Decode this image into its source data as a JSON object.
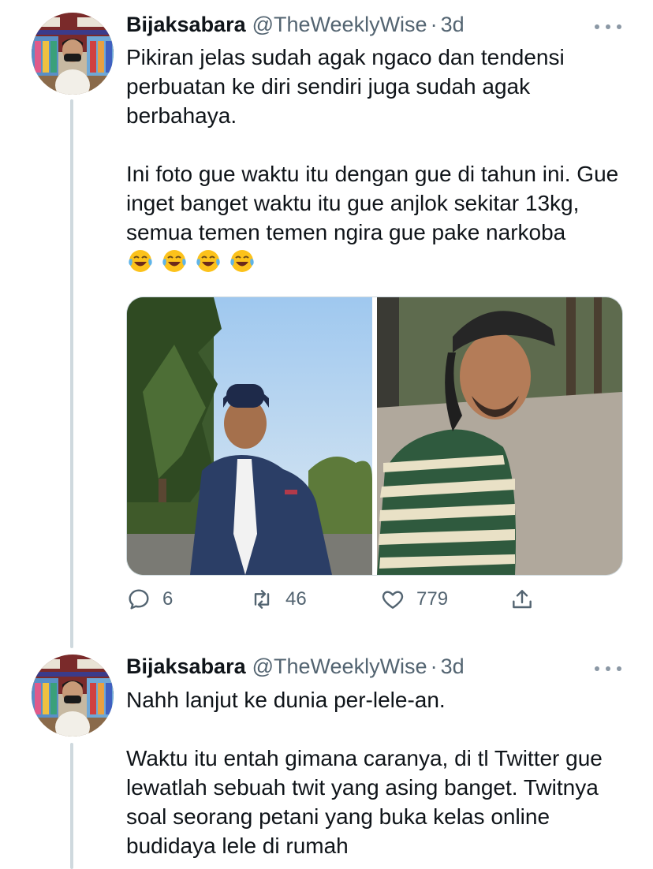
{
  "tweets": [
    {
      "name": "Bijaksabara",
      "handle": "@TheWeeklyWise",
      "separator": "·",
      "time": "3d",
      "paragraphs": [
        "Pikiran jelas sudah agak ngaco dan tendensi perbuatan ke diri sendiri juga sudah agak berbahaya.",
        "Ini foto gue waktu itu dengan gue di tahun ini. Gue inget banget waktu itu gue anjlok sekitar 13kg, semua temen temen ngira gue pake narkoba"
      ],
      "emoji": [
        "face-with-tears-of-joy",
        "face-with-tears-of-joy",
        "face-with-tears-of-joy",
        "face-with-tears-of-joy"
      ],
      "media": [
        {
          "description_icon": "photo-man-with-cap-and-suit"
        },
        {
          "description_icon": "photo-man-with-striped-shirt"
        }
      ],
      "actions": {
        "reply": "6",
        "retweet": "46",
        "like": "779"
      }
    },
    {
      "name": "Bijaksabara",
      "handle": "@TheWeeklyWise",
      "separator": "·",
      "time": "3d",
      "paragraphs": [
        "Nahh lanjut ke dunia per-lele-an.",
        "Waktu itu entah gimana caranya, di tl Twitter gue lewatlah sebuah twit yang asing banget. Twitnya soal seorang petani yang buka kelas online budidaya lele di rumah"
      ]
    }
  ],
  "colors": {
    "text": "#0f1419",
    "secondary": "#536471",
    "thread_line": "#cfd9de"
  }
}
